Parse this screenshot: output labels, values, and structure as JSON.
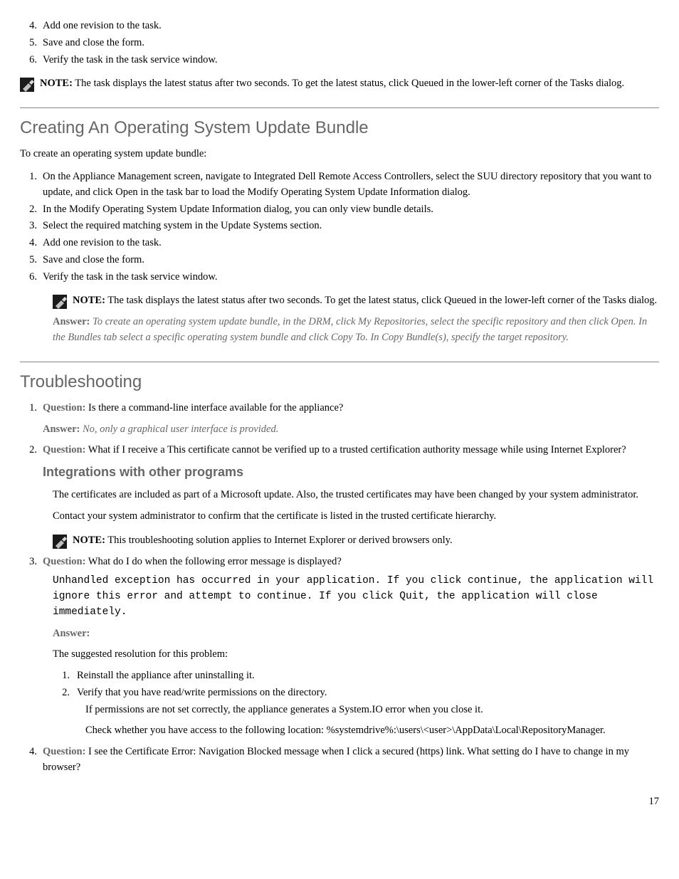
{
  "section1": {
    "steps": [
      "Add one revision to the task.",
      "Save and close the form.",
      "Verify the task in the task service window."
    ],
    "note": {
      "label": "NOTE:",
      "text": "The task displays the latest status after two seconds. To get the latest status, click Queued in the lower-left corner of the Tasks dialog."
    }
  },
  "section2": {
    "title": "Creating An Operating System Update Bundle",
    "intro": "To create an operating system update bundle:",
    "steps": [
      "On the Appliance Management screen, navigate to Integrated Dell Remote Access Controllers, select the SUU directory repository that you want to update, and click Open in the task bar to load the Modify Operating System Update Information dialog.",
      "In the Modify Operating System Update Information dialog, you can only view bundle details.",
      "Select the required matching system in the Update Systems section.",
      "Add one revision to the task.",
      "Save and close the form.",
      "Verify the task in the task service window."
    ],
    "note": {
      "label": "NOTE:",
      "text": "The task displays the latest status after two seconds. To get the latest status, click Queued in the lower-left corner of the Tasks dialog."
    },
    "answer_title": "Answer:",
    "answer_text": "To create an operating system update bundle, in the DRM, click My Repositories, select the specific repository and then click Open. In the Bundles tab select a specific operating system bundle and click Copy To. In Copy Bundle(s), specify the target repository."
  },
  "section3": {
    "title": "Troubleshooting",
    "questions": [
      {
        "num": "1.",
        "label": "Question:",
        "text": "Is there a command-line interface available for the appliance?",
        "answer_label": "Answer:",
        "answer": "No, only a graphical user interface is provided."
      },
      {
        "num": "2.",
        "label": "Question:",
        "text": "What if I receive a This certificate cannot be verified up to a trusted certification authority message while using Internet Explorer?",
        "answer_heading": "Integrations with other programs",
        "paras": [
          "The certificates are included as part of a Microsoft update. Also, the trusted certificates may have been changed by your system administrator.",
          "Contact your system administrator to confirm that the certificate is listed in the trusted certificate hierarchy."
        ],
        "note": {
          "label": "NOTE:",
          "text": "This troubleshooting solution applies to Internet Explorer or derived browsers only."
        }
      },
      {
        "num": "3.",
        "label": "Question:",
        "text": "What do I do when the following error message is displayed?",
        "code": "Unhandled exception has occurred in your application. If you click continue, the application will ignore this error and attempt to continue. If you click Quit, the application will close immediately.",
        "answer_label": "Answer:",
        "suggest_intro": "The suggested resolution for this problem:",
        "resolutions": [
          "Reinstall the appliance after uninstalling it.",
          "Verify that you have read/write permissions on the directory."
        ],
        "paras2": [
          "If permissions are not set correctly, the appliance generates a System.IO error when you close it.",
          "Check whether you have access to the following location: %systemdrive%:\\users\\<user>\\AppData\\Local\\RepositoryManager."
        ]
      },
      {
        "num": "4.",
        "label": "Question:",
        "text": "I see the Certificate Error: Navigation Blocked message when I click a secured (https) link. What setting do I have to change in my browser?"
      }
    ]
  },
  "page_number": "17"
}
